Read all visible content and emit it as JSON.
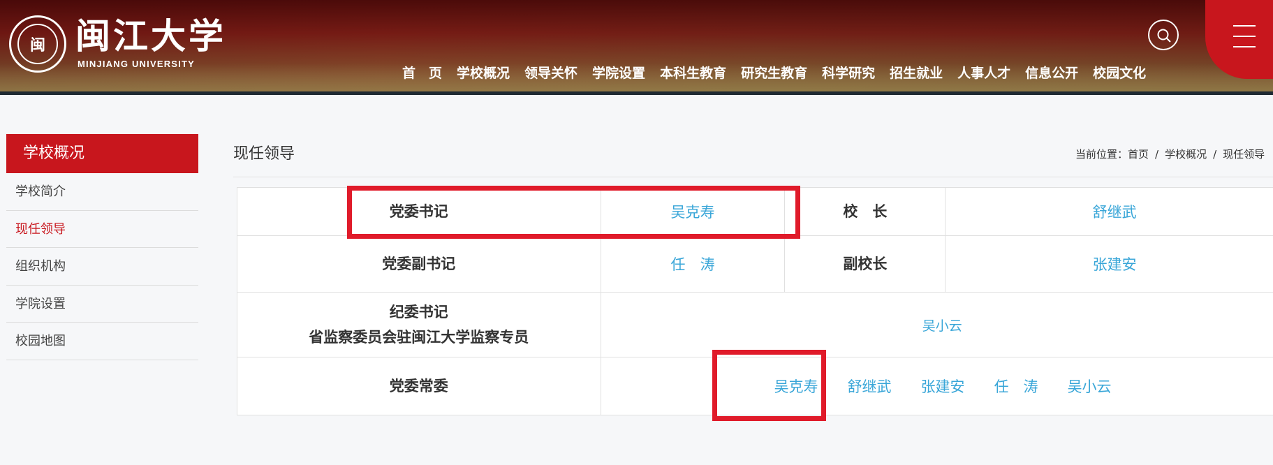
{
  "header": {
    "logo_seal_text": "闽",
    "logo_cn": "闽江大学",
    "logo_en": "MINJIANG UNIVERSITY",
    "search_icon": "search-icon",
    "menu_icon": "hamburger-menu-icon",
    "nav": [
      "首　页",
      "学校概况",
      "领导关怀",
      "学院设置",
      "本科生教育",
      "研究生教育",
      "科学研究",
      "招生就业",
      "人事人才",
      "信息公开",
      "校园文化"
    ]
  },
  "sidebar": {
    "title": "学校概况",
    "items": [
      {
        "label": "学校简介",
        "active": false
      },
      {
        "label": "现任领导",
        "active": true
      },
      {
        "label": "组织机构",
        "active": false
      },
      {
        "label": "学院设置",
        "active": false
      },
      {
        "label": "校园地图",
        "active": false
      }
    ]
  },
  "content": {
    "title": "现任领导",
    "breadcrumb": {
      "prefix": "当前位置：",
      "items": [
        "首页",
        "学校概况",
        "现任领导"
      ],
      "separator": "/"
    },
    "table": {
      "row1": {
        "label1": "党委书记",
        "name1": "吴克寿",
        "label2": "校　长",
        "name2": "舒继武"
      },
      "row2": {
        "label1": "党委副书记",
        "name1": "任　涛",
        "label2": "副校长",
        "name2": "张建安"
      },
      "row3": {
        "label_line1": "纪委书记",
        "label_line2": "省监察委员会驻闽江大学监察专员",
        "name": "吴小云"
      },
      "row4": {
        "label": "党委常委",
        "members": [
          "吴克寿",
          "舒继武",
          "张建安",
          "任　涛",
          "吴小云"
        ]
      }
    }
  },
  "colors": {
    "brand_red": "#c8161d",
    "link_blue": "#39a6d8",
    "highlight_red": "#e01b2a"
  }
}
